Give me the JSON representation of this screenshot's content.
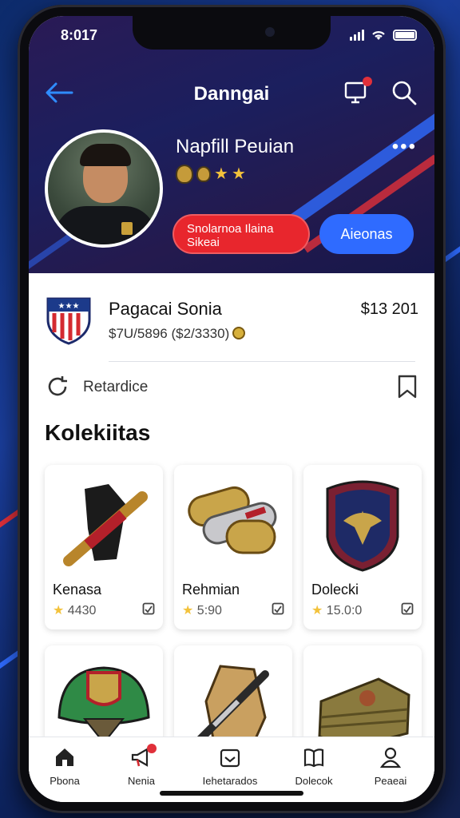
{
  "status_bar": {
    "time": "8:017"
  },
  "header": {
    "title": "Danngai"
  },
  "profile": {
    "name": "Napfill Peuian",
    "more_label": "•••",
    "primary_button": "Snolarnoa Ilaina Sikeai",
    "secondary_button": "Aieonas"
  },
  "team": {
    "name": "Pagacai Sonia",
    "sub": "$7U/5896 ($2/3330)",
    "price": "$13 201"
  },
  "refresh": {
    "label": "Retardice"
  },
  "collection": {
    "title": "Kolekiitas",
    "items": [
      {
        "name": "Kenasa",
        "rating": "4430"
      },
      {
        "name": "Rehmian",
        "rating": "5:90"
      },
      {
        "name": "Dolecki",
        "rating": "15.0:0"
      },
      {
        "name": "",
        "rating": ""
      },
      {
        "name": "",
        "rating": ""
      },
      {
        "name": "",
        "rating": ""
      }
    ]
  },
  "tabs": [
    {
      "label": "Pbona",
      "icon": "home-icon"
    },
    {
      "label": "Nenia",
      "icon": "megaphone-icon"
    },
    {
      "label": "Iehetarados",
      "icon": "inbox-icon"
    },
    {
      "label": "Dolecok",
      "icon": "book-icon"
    },
    {
      "label": "Peaeai",
      "icon": "person-icon"
    }
  ],
  "colors": {
    "accent_red": "#e8262d",
    "accent_blue": "#2f6bff",
    "hero_bg": "#1b1f5e",
    "star": "#f3c23b"
  }
}
